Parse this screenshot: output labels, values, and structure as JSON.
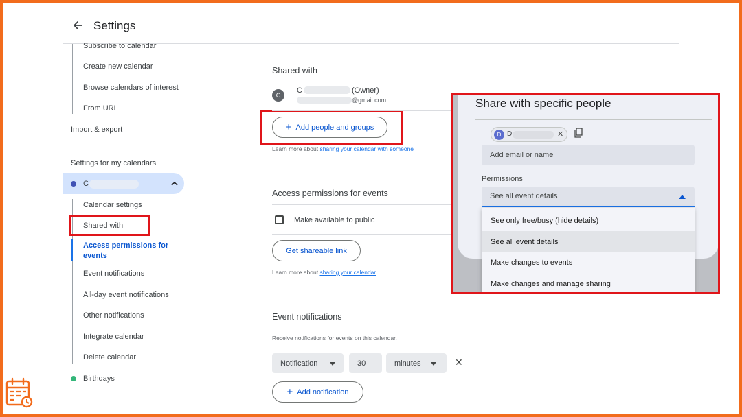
{
  "header": {
    "title": "Settings"
  },
  "sidebar": {
    "top_items": [
      "Subscribe to calendar",
      "Create new calendar",
      "Browse calendars of interest",
      "From URL"
    ],
    "import_export": "Import & export",
    "my_calendars_heading": "Settings for my calendars",
    "calendar_initial": "C",
    "sub_items": [
      "Calendar settings",
      "Shared with",
      "Access permissions for events",
      "Event notifications",
      "All-day event notifications",
      "Other notifications",
      "Integrate calendar",
      "Delete calendar"
    ],
    "other_calendar": "Birthdays"
  },
  "shared": {
    "title": "Shared with",
    "owner_initial": "C",
    "owner_name_initial": "C",
    "owner_label": "(Owner)",
    "owner_email_suffix": "@gmail.com",
    "add_people_label": "Add people and groups",
    "learn_prefix": "Learn more about",
    "learn_link": "sharing your calendar with someone"
  },
  "access": {
    "title": "Access permissions for events",
    "public_label": "Make available to public",
    "get_link_label": "Get shareable link",
    "learn_prefix": "Learn more about",
    "learn_link": "sharing your calendar"
  },
  "notifications": {
    "title": "Event notifications",
    "description": "Receive notifications for events on this calendar.",
    "type_value": "Notification",
    "amount_value": "30",
    "unit_value": "minutes",
    "remove_icon": "✕",
    "add_label": "Add notification"
  },
  "dialog": {
    "title": "Share with specific people",
    "chip_initial": "D",
    "chip_name": "D",
    "input_placeholder": "Add email or name",
    "permissions_label": "Permissions",
    "selected_permission": "See all event details",
    "options": [
      "See only free/busy (hide details)",
      "See all event details",
      "Make changes to events",
      "Make changes and manage sharing"
    ]
  },
  "colors": {
    "accent": "#1a73e8",
    "highlight_box": "#e0151a",
    "frame": "#f26c1d",
    "calendar_dot": "#3f51b5",
    "birthdays_dot": "#33b679"
  }
}
